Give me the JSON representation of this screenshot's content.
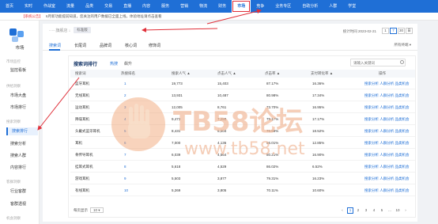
{
  "topnav": {
    "items": [
      {
        "label": "首页"
      },
      {
        "label": "实时"
      },
      {
        "label": "作战室"
      },
      {
        "label": "流量"
      },
      {
        "label": "品类"
      },
      {
        "label": "交易"
      },
      {
        "label": "直播"
      },
      {
        "label": "内容"
      },
      {
        "label": "服务"
      },
      {
        "label": "营销"
      },
      {
        "label": "物流"
      },
      {
        "label": "财务"
      },
      {
        "label": "市场"
      },
      {
        "label": "竞争"
      },
      {
        "label": "业务专区"
      },
      {
        "label": "自助分析"
      },
      {
        "label": "人群"
      },
      {
        "label": "学堂"
      }
    ]
  },
  "notice": {
    "tag": "【系统公告】",
    "text": "6月新功能提前知道，您关注的用户数据已全面上线，体验地址请点击查看"
  },
  "sidebar": {
    "title": "市场",
    "groups": [
      "市场监控",
      "供给洞察",
      "搜索洞察",
      "客群洞察",
      "机会洞察"
    ],
    "items": [
      {
        "label": "监控看板"
      },
      {
        "label": "市场大盘"
      },
      {
        "label": "市场排行"
      },
      {
        "label": "搜索排行"
      },
      {
        "label": "搜索分析"
      },
      {
        "label": "搜索人群"
      },
      {
        "label": "内容排行"
      },
      {
        "label": "行业客群"
      },
      {
        "label": "客群透视"
      }
    ]
  },
  "header": {
    "shop_name": "·····旗舰店 ↓",
    "shop_badge": "标准版",
    "stat_date": "统计时间 2023-02-21",
    "periods": [
      "1",
      "7",
      "30",
      "日"
    ],
    "all_channels": "所有终端 ▾"
  },
  "subtabs": [
    "搜索词",
    "长尾词",
    "品牌词",
    "核心词",
    "修饰词"
  ],
  "card": {
    "title": "搜索词排行",
    "tabs": [
      "热搜",
      "飙升"
    ],
    "search_placeholder": "请输入关键词",
    "columns": [
      "搜索词",
      "热搜排名",
      "搜索人气 ▲",
      "点击人气 ▲",
      "点击率 ▲",
      "支付转化率 ▲",
      "操作"
    ],
    "rows": [
      {
        "word": "蓝牙耳机",
        "rank": "1",
        "search": "19,773",
        "click": "15,403",
        "ctr": "87.17%",
        "cvr": "16.36%",
        "ops": "搜索分析  人群分析  品类机会"
      },
      {
        "word": "无线耳机",
        "rank": "2",
        "search": "13,931",
        "click": "10,487",
        "ctr": "80.98%",
        "cvr": "17.34%",
        "ops": "搜索分析  人群分析  品类机会"
      },
      {
        "word": "运动耳机",
        "rank": "3",
        "search": "12,005",
        "click": "8,761",
        "ctr": "73.70%",
        "cvr": "16.95%",
        "ops": "搜索分析  人群分析  品类机会"
      },
      {
        "word": "降噪耳机",
        "rank": "4",
        "search": "9,473",
        "click": "7,280",
        "ctr": "79.17%",
        "cvr": "17.17%",
        "ops": "搜索分析  人群分析  品类机会"
      },
      {
        "word": "头戴式蓝牙耳机",
        "rank": "5",
        "search": "8,431",
        "click": "6,004",
        "ctr": "76.59%",
        "cvr": "18.52%",
        "ops": "搜索分析  人群分析  品类机会"
      },
      {
        "word": "耳机",
        "rank": "6",
        "search": "7,000",
        "click": "4,136",
        "ctr": "56.01%",
        "cvr": "12.85%",
        "ops": "搜索分析  人群分析  品类机会"
      },
      {
        "word": "骨传导耳机",
        "rank": "7",
        "search": "6,039",
        "click": "4,564",
        "ctr": "80.21%",
        "cvr": "16.90%",
        "ops": "搜索分析  人群分析  品类机会"
      },
      {
        "word": "挂耳式耳机",
        "rank": "8",
        "search": "5,618",
        "click": "4,529",
        "ctr": "86.02%",
        "cvr": "6.52%",
        "ops": "搜索分析  人群分析  品类机会"
      },
      {
        "word": "游戏耳机",
        "rank": "9",
        "search": "5,503",
        "click": "3,877",
        "ctr": "79.31%",
        "cvr": "16.23%",
        "ops": "搜索分析  人群分析  品类机会"
      },
      {
        "word": "有线耳机",
        "rank": "10",
        "search": "5,269",
        "click": "3,805",
        "ctr": "70.11%",
        "cvr": "10.60%",
        "ops": "搜索分析  人群分析  品类机会"
      }
    ],
    "page_size_label": "每页显示",
    "page_size": "10 ▾",
    "pages": [
      "‹",
      "1",
      "2",
      "3",
      "4",
      "5",
      "…",
      "10",
      "›"
    ]
  },
  "watermark": {
    "title": "TB58论坛",
    "url": "www.tb58.net"
  },
  "colors": {
    "brand": "#1f6fd6",
    "annotation": "#e0303a"
  }
}
